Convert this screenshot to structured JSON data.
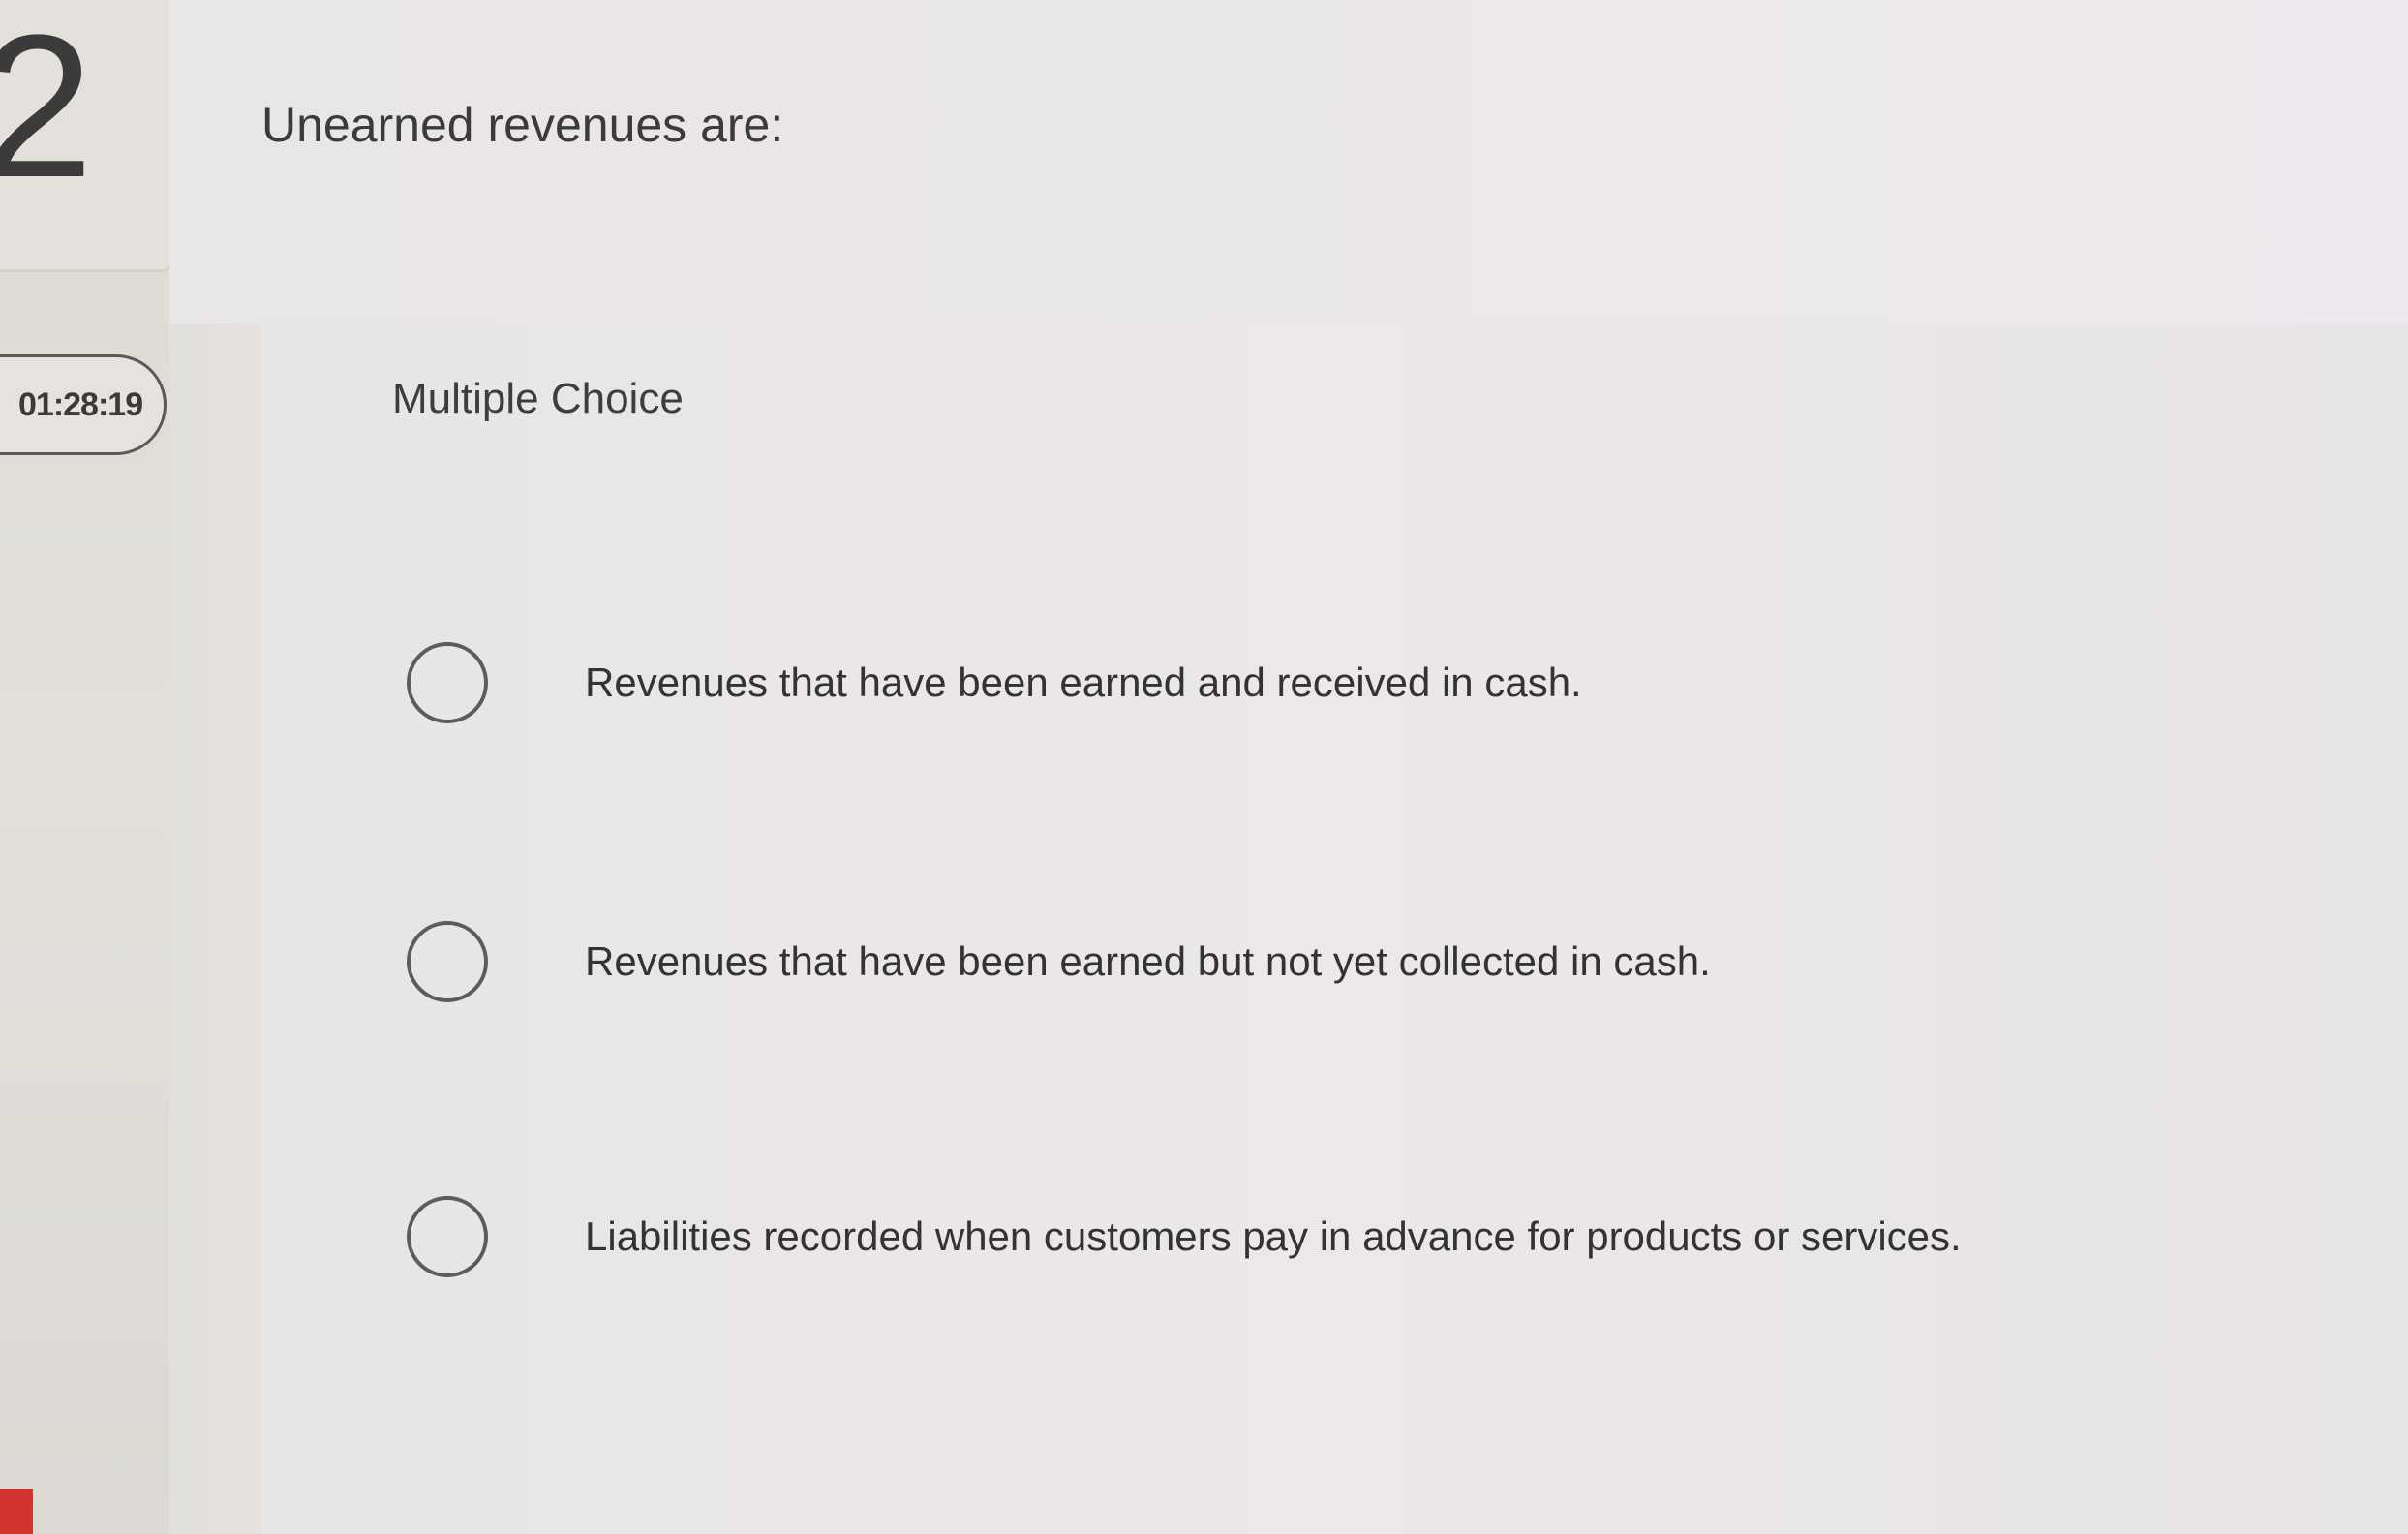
{
  "question": {
    "number": "2",
    "timer": "01:28:19",
    "text": "Unearned revenues are:",
    "type": "Multiple Choice"
  },
  "options": [
    {
      "label": "Revenues that have been earned and received in cash.",
      "selected": false
    },
    {
      "label": "Revenues that have been earned but not yet collected in cash.",
      "selected": false
    },
    {
      "label": "Liabilities recorded when customers pay in advance for products or services.",
      "selected": false
    }
  ],
  "colors": {
    "accent_marker": "#d2342f",
    "text": "#333333",
    "radio_border": "#5c5c5c"
  }
}
